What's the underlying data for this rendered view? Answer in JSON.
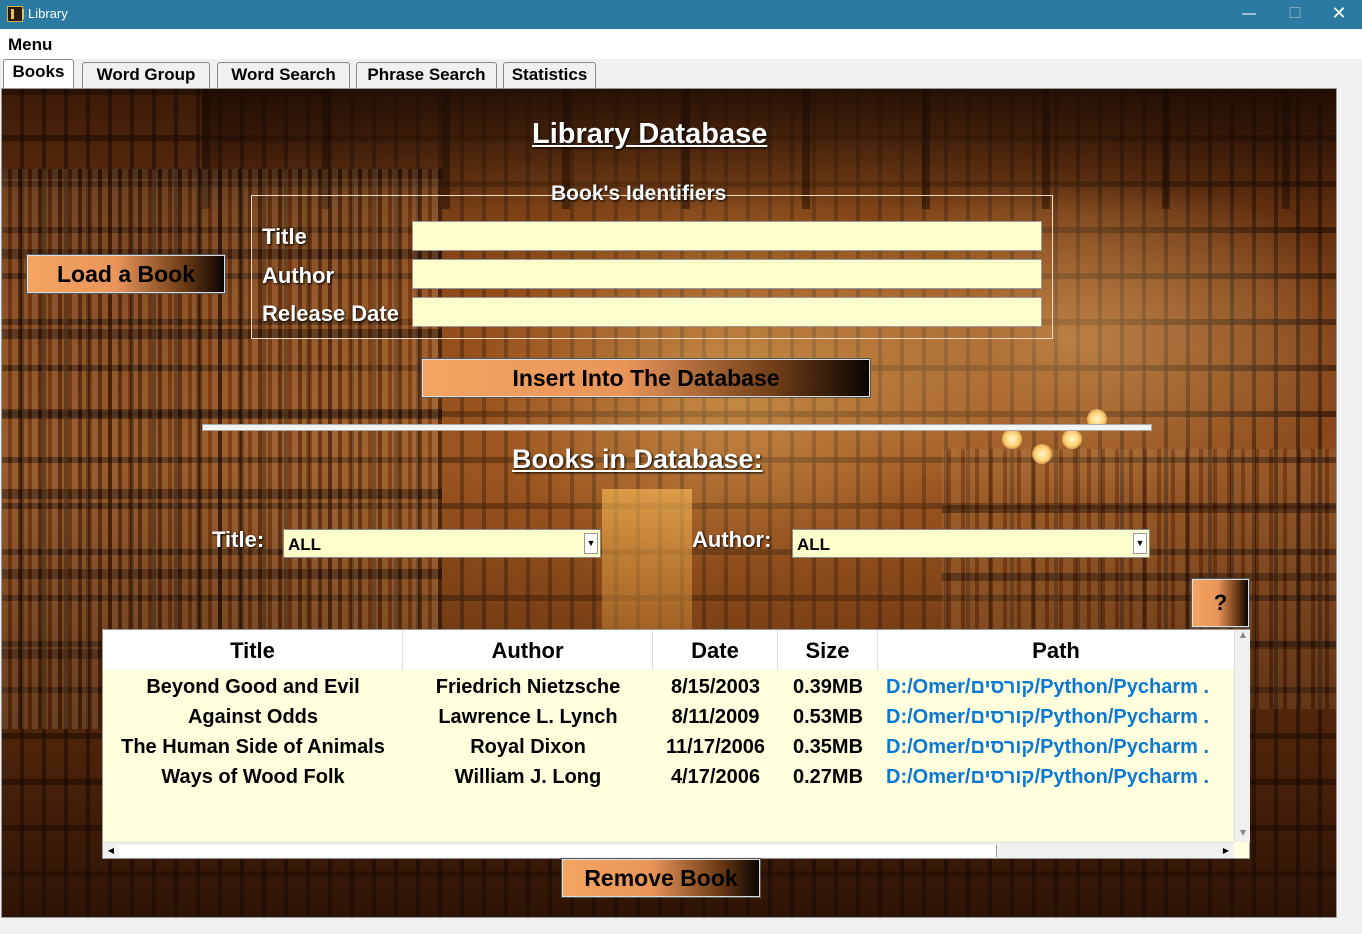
{
  "window": {
    "title": "Library",
    "minimize": "—",
    "maximize": "☐",
    "close": "✕"
  },
  "menubar": {
    "menu": "Menu"
  },
  "tabs": [
    "Books",
    "Word Group",
    "Word Search",
    "Phrase Search",
    "Statistics"
  ],
  "books_tab": {
    "heading": "Library Database",
    "identifiers": {
      "legend": "Book's Identifiers",
      "title_label": "Title",
      "author_label": "Author",
      "release_date_label": "Release Date",
      "title_value": "",
      "author_value": "",
      "release_date_value": ""
    },
    "load_button": "Load a Book",
    "insert_button": "Insert Into The Database",
    "books_heading": "Books in Database:",
    "filters": {
      "title_label": "Title:",
      "title_value": "ALL",
      "author_label": "Author:",
      "author_value": "ALL"
    },
    "help_button": "?",
    "table": {
      "columns": [
        "Title",
        "Author",
        "Date",
        "Size",
        "Path"
      ],
      "rows": [
        [
          "Beyond Good and Evil",
          "Friedrich Nietzsche",
          "8/15/2003",
          "0.39MB",
          "D:/Omer/קורסים/Python/Pycharm ."
        ],
        [
          "Against Odds",
          "Lawrence L. Lynch",
          "8/11/2009",
          "0.53MB",
          "D:/Omer/קורסים/Python/Pycharm ."
        ],
        [
          "The Human Side of Animals",
          "Royal Dixon",
          "11/17/2006",
          "0.35MB",
          "D:/Omer/קורסים/Python/Pycharm ."
        ],
        [
          "Ways of Wood Folk",
          "William J. Long",
          "4/17/2006",
          "0.27MB",
          "D:/Omer/קורסים/Python/Pycharm ."
        ]
      ]
    },
    "remove_button": "Remove Book"
  }
}
